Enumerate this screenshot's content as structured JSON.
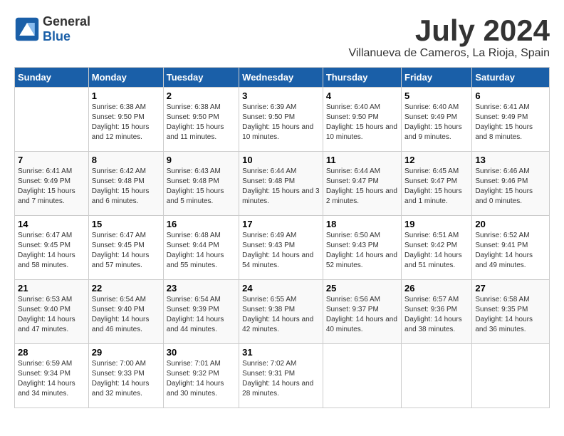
{
  "header": {
    "logo_text_general": "General",
    "logo_text_blue": "Blue",
    "month_year": "July 2024",
    "location": "Villanueva de Cameros, La Rioja, Spain"
  },
  "weekdays": [
    "Sunday",
    "Monday",
    "Tuesday",
    "Wednesday",
    "Thursday",
    "Friday",
    "Saturday"
  ],
  "weeks": [
    [
      {
        "day": "",
        "sunrise": "",
        "sunset": "",
        "daylight": ""
      },
      {
        "day": "1",
        "sunrise": "Sunrise: 6:38 AM",
        "sunset": "Sunset: 9:50 PM",
        "daylight": "Daylight: 15 hours and 12 minutes."
      },
      {
        "day": "2",
        "sunrise": "Sunrise: 6:38 AM",
        "sunset": "Sunset: 9:50 PM",
        "daylight": "Daylight: 15 hours and 11 minutes."
      },
      {
        "day": "3",
        "sunrise": "Sunrise: 6:39 AM",
        "sunset": "Sunset: 9:50 PM",
        "daylight": "Daylight: 15 hours and 10 minutes."
      },
      {
        "day": "4",
        "sunrise": "Sunrise: 6:40 AM",
        "sunset": "Sunset: 9:50 PM",
        "daylight": "Daylight: 15 hours and 10 minutes."
      },
      {
        "day": "5",
        "sunrise": "Sunrise: 6:40 AM",
        "sunset": "Sunset: 9:49 PM",
        "daylight": "Daylight: 15 hours and 9 minutes."
      },
      {
        "day": "6",
        "sunrise": "Sunrise: 6:41 AM",
        "sunset": "Sunset: 9:49 PM",
        "daylight": "Daylight: 15 hours and 8 minutes."
      }
    ],
    [
      {
        "day": "7",
        "sunrise": "Sunrise: 6:41 AM",
        "sunset": "Sunset: 9:49 PM",
        "daylight": "Daylight: 15 hours and 7 minutes."
      },
      {
        "day": "8",
        "sunrise": "Sunrise: 6:42 AM",
        "sunset": "Sunset: 9:48 PM",
        "daylight": "Daylight: 15 hours and 6 minutes."
      },
      {
        "day": "9",
        "sunrise": "Sunrise: 6:43 AM",
        "sunset": "Sunset: 9:48 PM",
        "daylight": "Daylight: 15 hours and 5 minutes."
      },
      {
        "day": "10",
        "sunrise": "Sunrise: 6:44 AM",
        "sunset": "Sunset: 9:48 PM",
        "daylight": "Daylight: 15 hours and 3 minutes."
      },
      {
        "day": "11",
        "sunrise": "Sunrise: 6:44 AM",
        "sunset": "Sunset: 9:47 PM",
        "daylight": "Daylight: 15 hours and 2 minutes."
      },
      {
        "day": "12",
        "sunrise": "Sunrise: 6:45 AM",
        "sunset": "Sunset: 9:47 PM",
        "daylight": "Daylight: 15 hours and 1 minute."
      },
      {
        "day": "13",
        "sunrise": "Sunrise: 6:46 AM",
        "sunset": "Sunset: 9:46 PM",
        "daylight": "Daylight: 15 hours and 0 minutes."
      }
    ],
    [
      {
        "day": "14",
        "sunrise": "Sunrise: 6:47 AM",
        "sunset": "Sunset: 9:45 PM",
        "daylight": "Daylight: 14 hours and 58 minutes."
      },
      {
        "day": "15",
        "sunrise": "Sunrise: 6:47 AM",
        "sunset": "Sunset: 9:45 PM",
        "daylight": "Daylight: 14 hours and 57 minutes."
      },
      {
        "day": "16",
        "sunrise": "Sunrise: 6:48 AM",
        "sunset": "Sunset: 9:44 PM",
        "daylight": "Daylight: 14 hours and 55 minutes."
      },
      {
        "day": "17",
        "sunrise": "Sunrise: 6:49 AM",
        "sunset": "Sunset: 9:43 PM",
        "daylight": "Daylight: 14 hours and 54 minutes."
      },
      {
        "day": "18",
        "sunrise": "Sunrise: 6:50 AM",
        "sunset": "Sunset: 9:43 PM",
        "daylight": "Daylight: 14 hours and 52 minutes."
      },
      {
        "day": "19",
        "sunrise": "Sunrise: 6:51 AM",
        "sunset": "Sunset: 9:42 PM",
        "daylight": "Daylight: 14 hours and 51 minutes."
      },
      {
        "day": "20",
        "sunrise": "Sunrise: 6:52 AM",
        "sunset": "Sunset: 9:41 PM",
        "daylight": "Daylight: 14 hours and 49 minutes."
      }
    ],
    [
      {
        "day": "21",
        "sunrise": "Sunrise: 6:53 AM",
        "sunset": "Sunset: 9:40 PM",
        "daylight": "Daylight: 14 hours and 47 minutes."
      },
      {
        "day": "22",
        "sunrise": "Sunrise: 6:54 AM",
        "sunset": "Sunset: 9:40 PM",
        "daylight": "Daylight: 14 hours and 46 minutes."
      },
      {
        "day": "23",
        "sunrise": "Sunrise: 6:54 AM",
        "sunset": "Sunset: 9:39 PM",
        "daylight": "Daylight: 14 hours and 44 minutes."
      },
      {
        "day": "24",
        "sunrise": "Sunrise: 6:55 AM",
        "sunset": "Sunset: 9:38 PM",
        "daylight": "Daylight: 14 hours and 42 minutes."
      },
      {
        "day": "25",
        "sunrise": "Sunrise: 6:56 AM",
        "sunset": "Sunset: 9:37 PM",
        "daylight": "Daylight: 14 hours and 40 minutes."
      },
      {
        "day": "26",
        "sunrise": "Sunrise: 6:57 AM",
        "sunset": "Sunset: 9:36 PM",
        "daylight": "Daylight: 14 hours and 38 minutes."
      },
      {
        "day": "27",
        "sunrise": "Sunrise: 6:58 AM",
        "sunset": "Sunset: 9:35 PM",
        "daylight": "Daylight: 14 hours and 36 minutes."
      }
    ],
    [
      {
        "day": "28",
        "sunrise": "Sunrise: 6:59 AM",
        "sunset": "Sunset: 9:34 PM",
        "daylight": "Daylight: 14 hours and 34 minutes."
      },
      {
        "day": "29",
        "sunrise": "Sunrise: 7:00 AM",
        "sunset": "Sunset: 9:33 PM",
        "daylight": "Daylight: 14 hours and 32 minutes."
      },
      {
        "day": "30",
        "sunrise": "Sunrise: 7:01 AM",
        "sunset": "Sunset: 9:32 PM",
        "daylight": "Daylight: 14 hours and 30 minutes."
      },
      {
        "day": "31",
        "sunrise": "Sunrise: 7:02 AM",
        "sunset": "Sunset: 9:31 PM",
        "daylight": "Daylight: 14 hours and 28 minutes."
      },
      {
        "day": "",
        "sunrise": "",
        "sunset": "",
        "daylight": ""
      },
      {
        "day": "",
        "sunrise": "",
        "sunset": "",
        "daylight": ""
      },
      {
        "day": "",
        "sunrise": "",
        "sunset": "",
        "daylight": ""
      }
    ]
  ]
}
